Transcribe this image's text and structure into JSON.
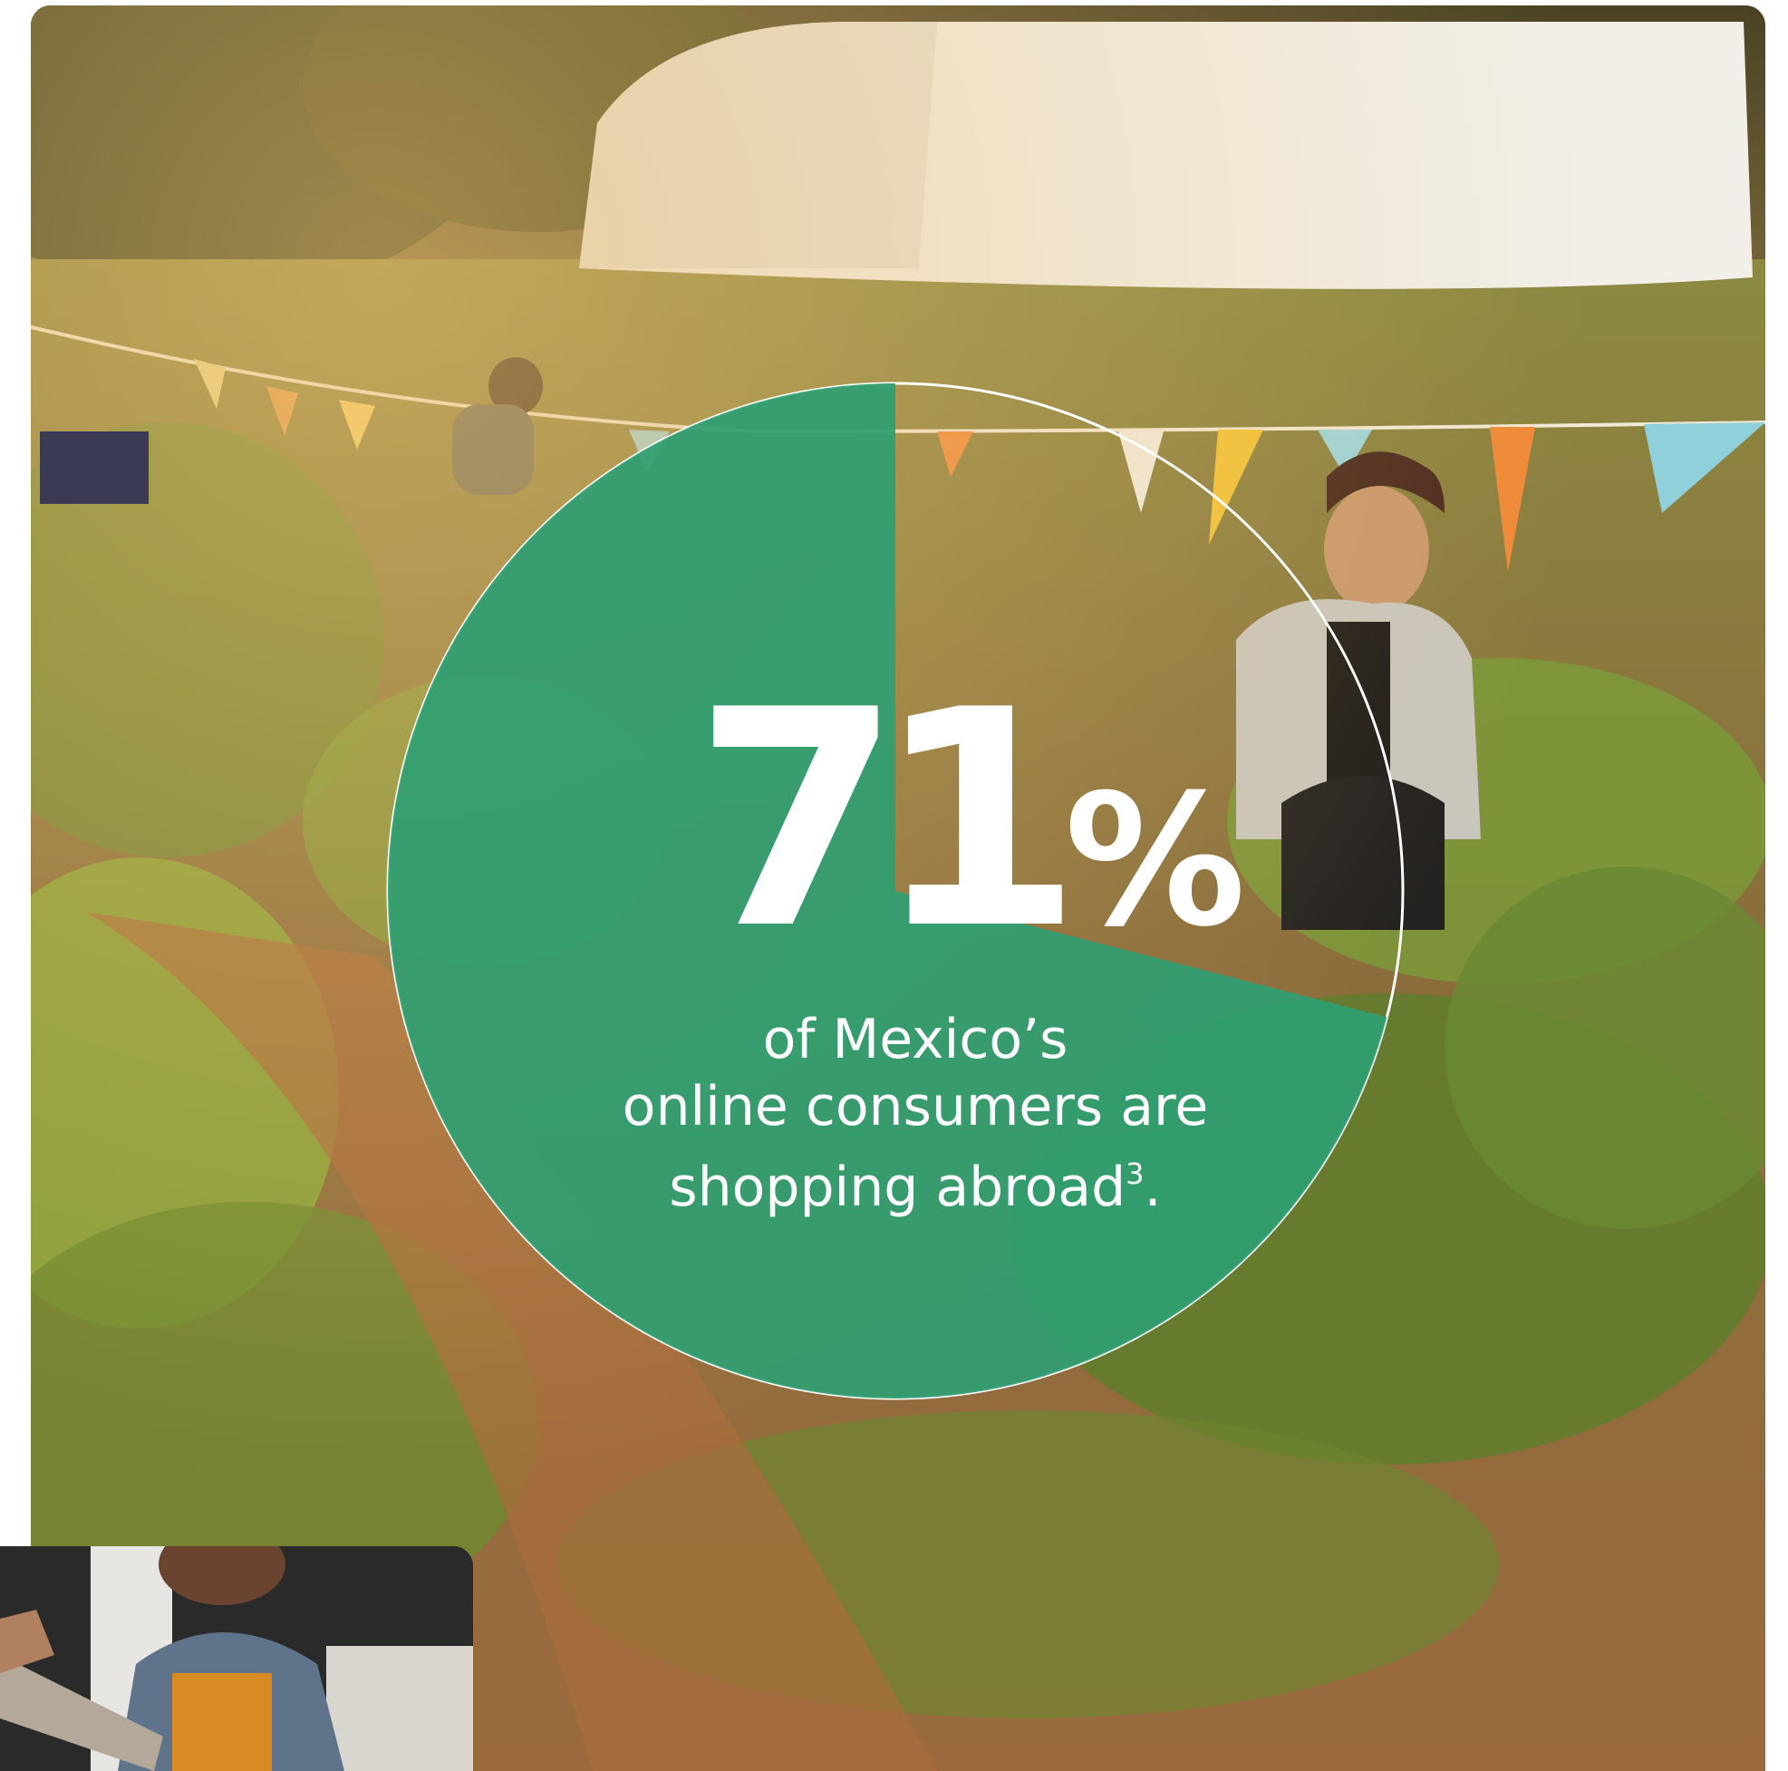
{
  "stat": {
    "value": "71",
    "unit": "%",
    "caption_lines": [
      "of Mexico’s",
      "online consumers are",
      "shopping abroad"
    ],
    "footnote": "3",
    "caption_end": ".",
    "percent_value": 71,
    "accent_color": "#2f9e72",
    "ring_color": "#ffffff"
  },
  "images": {
    "main_photo": "garden-photo",
    "inset_photo": "person-with-parcel-photo"
  }
}
